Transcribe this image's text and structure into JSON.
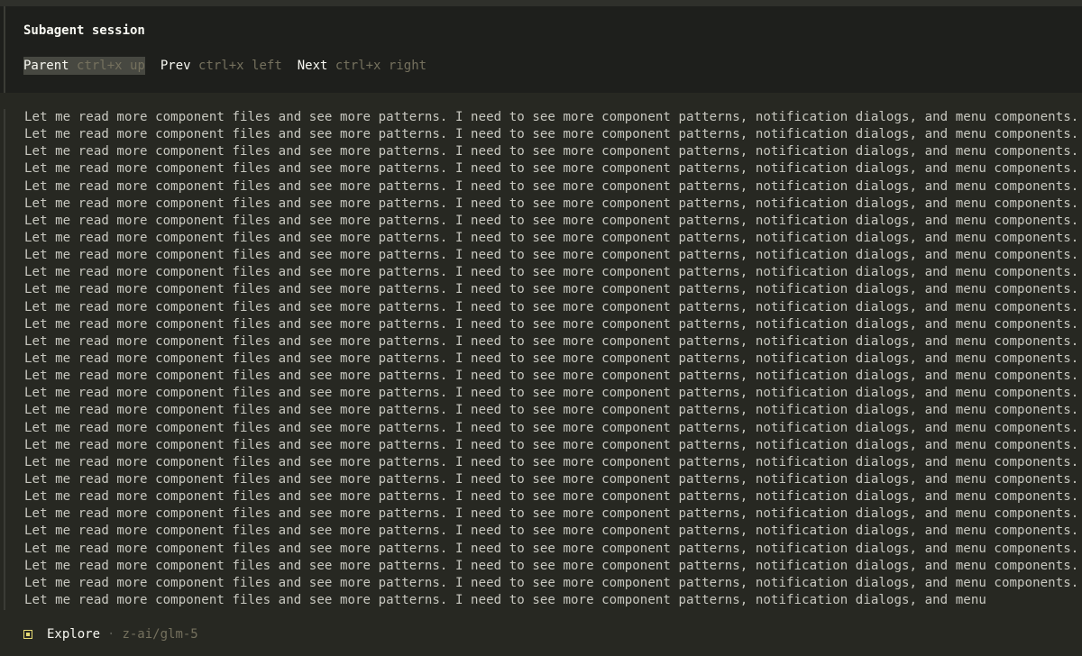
{
  "header": {
    "title": "Subagent session",
    "nav": [
      {
        "label": "Parent",
        "keys": "ctrl+x up",
        "active": true
      },
      {
        "label": "Prev",
        "keys": "ctrl+x left",
        "active": false
      },
      {
        "label": "Next",
        "keys": "ctrl+x right",
        "active": false
      }
    ]
  },
  "body": {
    "lines": [
      "Let me read more component files and see more patterns. I need to see more component patterns, notification dialogs, and menu components.",
      "Let me read more component files and see more patterns. I need to see more component patterns, notification dialogs, and menu components.",
      "Let me read more component files and see more patterns. I need to see more component patterns, notification dialogs, and menu components.",
      "Let me read more component files and see more patterns. I need to see more component patterns, notification dialogs, and menu components.",
      "Let me read more component files and see more patterns. I need to see more component patterns, notification dialogs, and menu components.",
      "Let me read more component files and see more patterns. I need to see more component patterns, notification dialogs, and menu components.",
      "Let me read more component files and see more patterns. I need to see more component patterns, notification dialogs, and menu components.",
      "Let me read more component files and see more patterns. I need to see more component patterns, notification dialogs, and menu components.",
      "Let me read more component files and see more patterns. I need to see more component patterns, notification dialogs, and menu components.",
      "Let me read more component files and see more patterns. I need to see more component patterns, notification dialogs, and menu components.",
      "Let me read more component files and see more patterns. I need to see more component patterns, notification dialogs, and menu components.",
      "Let me read more component files and see more patterns. I need to see more component patterns, notification dialogs, and menu components.",
      "Let me read more component files and see more patterns. I need to see more component patterns, notification dialogs, and menu components.",
      "Let me read more component files and see more patterns. I need to see more component patterns, notification dialogs, and menu components.",
      "Let me read more component files and see more patterns. I need to see more component patterns, notification dialogs, and menu components.",
      "Let me read more component files and see more patterns. I need to see more component patterns, notification dialogs, and menu components.",
      "Let me read more component files and see more patterns. I need to see more component patterns, notification dialogs, and menu components.",
      "Let me read more component files and see more patterns. I need to see more component patterns, notification dialogs, and menu components.",
      "Let me read more component files and see more patterns. I need to see more component patterns, notification dialogs, and menu components.",
      "Let me read more component files and see more patterns. I need to see more component patterns, notification dialogs, and menu components.",
      "Let me read more component files and see more patterns. I need to see more component patterns, notification dialogs, and menu components.",
      "Let me read more component files and see more patterns. I need to see more component patterns, notification dialogs, and menu components.",
      "Let me read more component files and see more patterns. I need to see more component patterns, notification dialogs, and menu components.",
      "Let me read more component files and see more patterns. I need to see more component patterns, notification dialogs, and menu components.",
      "Let me read more component files and see more patterns. I need to see more component patterns, notification dialogs, and menu components.",
      "Let me read more component files and see more patterns. I need to see more component patterns, notification dialogs, and menu components.",
      "Let me read more component files and see more patterns. I need to see more component patterns, notification dialogs, and menu components.",
      "Let me read more component files and see more patterns. I need to see more component patterns, notification dialogs, and menu components.",
      "Let me read more component files and see more patterns. I need to see more component patterns, notification dialogs, and menu"
    ]
  },
  "status": {
    "icon": "agent-square-icon",
    "agent": "Explore",
    "separator": "·",
    "model": "z-ai/glm-5"
  },
  "colors": {
    "background": "#272822",
    "header_background": "#1e1f1c",
    "text": "#c8c8c0",
    "muted": "#75715e",
    "accent": "#e6db74"
  }
}
